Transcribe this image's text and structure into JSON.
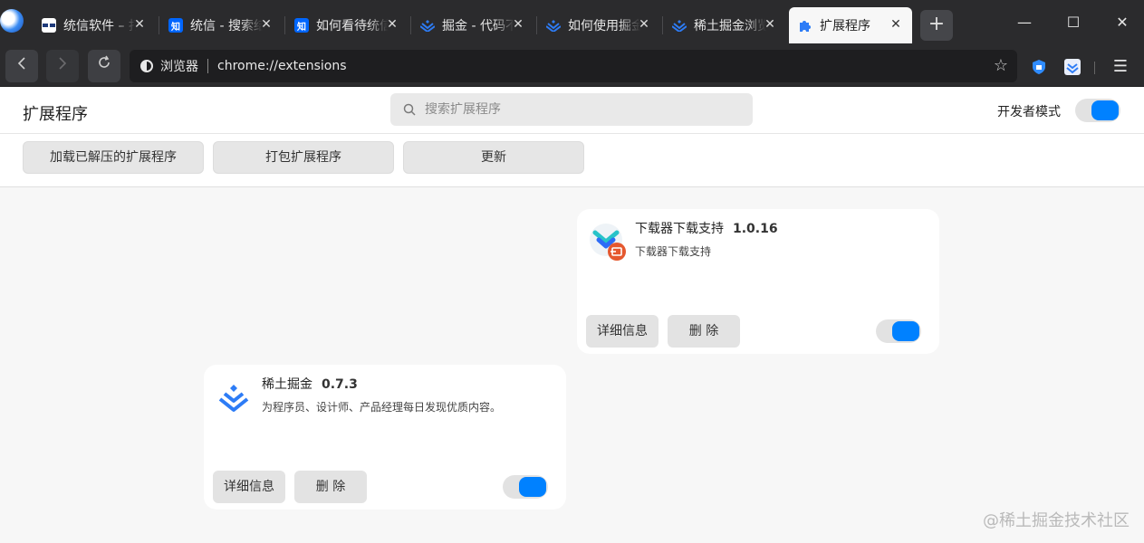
{
  "browser": {
    "tabs": [
      {
        "title": "统信软件 – 打",
        "favicon": "uos-icon",
        "fav_color": "#ffffff",
        "fav_bg": "#1e3a7a",
        "active": false
      },
      {
        "title": "统信 - 搜索结",
        "favicon": "zhihu-icon",
        "fav_text": "知",
        "fav_bg": "#0066ff",
        "active": false
      },
      {
        "title": "如何看待统信",
        "favicon": "zhihu-icon",
        "fav_text": "知",
        "fav_bg": "#0066ff",
        "active": false
      },
      {
        "title": "掘金 - 代码不",
        "favicon": "juejin-icon",
        "active": false
      },
      {
        "title": "如何使用掘金",
        "favicon": "juejin-icon",
        "active": false
      },
      {
        "title": "稀土掘金浏览",
        "favicon": "juejin-icon",
        "active": false
      },
      {
        "title": "扩展程序",
        "favicon": "puzzle-icon",
        "active": true
      }
    ],
    "new_tab_label": "+",
    "omnibox": {
      "origin": "浏览器",
      "url": "chrome://extensions"
    },
    "accent": "#0081ff"
  },
  "header": {
    "title": "扩展程序",
    "search_placeholder": "搜索扩展程序",
    "dev_mode_label": "开发者模式",
    "dev_mode_on": true
  },
  "toolbar": {
    "load_unpacked": "加载已解压的扩展程序",
    "pack": "打包扩展程序",
    "update": "更新"
  },
  "extensions": [
    {
      "name": "下载器下载支持",
      "version": "1.0.16",
      "description": "下载器下载支持",
      "details_label": "详细信息",
      "remove_label": "删 除",
      "enabled": true
    },
    {
      "name": "稀土掘金",
      "version": "0.7.3",
      "description": "为程序员、设计师、产品经理每日发现优质内容。",
      "details_label": "详细信息",
      "remove_label": "删 除",
      "enabled": true
    }
  ],
  "watermark": "@稀土掘金技术社区"
}
